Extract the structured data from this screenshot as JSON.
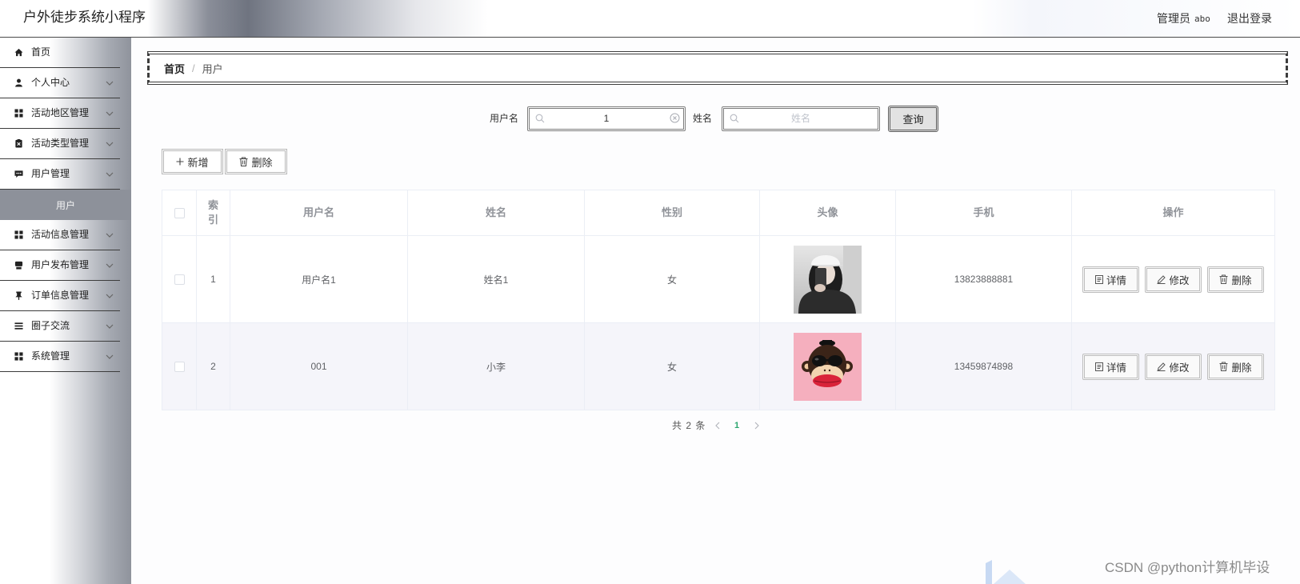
{
  "header": {
    "title": "户外徒步系统小程序",
    "user_label": "管理员",
    "username": "abo",
    "logout": "退出登录"
  },
  "sidebar": {
    "items": [
      {
        "label": "首页",
        "icon": "home-icon"
      },
      {
        "label": "个人中心",
        "icon": "user-icon"
      },
      {
        "label": "活动地区管理",
        "icon": "grid-icon"
      },
      {
        "label": "活动类型管理",
        "icon": "clipboard-icon"
      },
      {
        "label": "用户管理",
        "icon": "message-icon"
      },
      {
        "label": "用户"
      },
      {
        "label": "活动信息管理",
        "icon": "grid-icon"
      },
      {
        "label": "用户发布管理",
        "icon": "printer-icon"
      },
      {
        "label": "订单信息管理",
        "icon": "pin-icon"
      },
      {
        "label": "圈子交流",
        "icon": "list-icon"
      },
      {
        "label": "系统管理",
        "icon": "grid-icon"
      }
    ]
  },
  "breadcrumb": {
    "home": "首页",
    "separator": "/",
    "current": "用户"
  },
  "search": {
    "username_label": "用户名",
    "username_value": "1",
    "name_label": "姓名",
    "name_placeholder": "姓名",
    "query_button": "查询"
  },
  "toolbar": {
    "add": "新增",
    "delete": "删除"
  },
  "table": {
    "headers": [
      "索引",
      "用户名",
      "姓名",
      "性别",
      "头像",
      "手机",
      "操作"
    ],
    "rows": [
      {
        "index": "1",
        "username": "用户名1",
        "name": "姓名1",
        "gender": "女",
        "phone": "13823888881"
      },
      {
        "index": "2",
        "username": "001",
        "name": "小李",
        "gender": "女",
        "phone": "13459874898"
      }
    ],
    "actions": [
      "详情",
      "修改",
      "删除"
    ]
  },
  "pagination": {
    "total": "共 2 条",
    "current_page": "1"
  },
  "watermark": "CSDN @python计算机毕设",
  "colors": {
    "submenu_active_bg": "#8d919a",
    "pagination_active": "#2ba56e",
    "alt_row_bg": "#f5f5fa"
  }
}
